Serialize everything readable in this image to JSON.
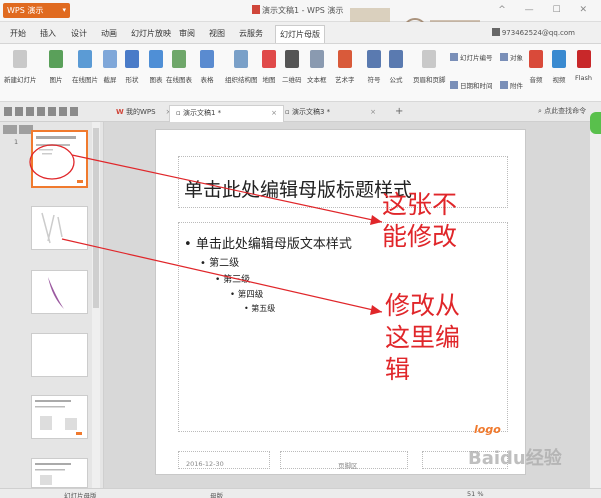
{
  "app": {
    "name": "WPS 演示",
    "window_title": "演示文稿1 - WPS 演示",
    "account": "973462524@qq.com"
  },
  "menu_tabs": [
    "开始",
    "插入",
    "设计",
    "动画",
    "幻灯片放映",
    "审阅",
    "视图",
    "云服务",
    "幻灯片母版"
  ],
  "ribbon": {
    "buttons": [
      "新建幻灯片",
      "图片",
      "在线图片",
      "截屏",
      "形状",
      "图表",
      "在线图表",
      "表格",
      "组织结构图",
      "地图",
      "二维码",
      "文本框",
      "艺术字",
      "符号",
      "公式",
      "页眉和页脚",
      "音频",
      "视频",
      "Flash"
    ],
    "small": [
      "幻灯片编号",
      "对象",
      "日期和时间",
      "附件"
    ]
  },
  "doc_tabs": {
    "home": "我的WPS",
    "tab1": "演示文稿1 *",
    "tab2": "演示文稿3 *",
    "search": "点此查找命令"
  },
  "slide": {
    "title": "单击此处编辑母版标题样式",
    "level1": "单击此处编辑母版文本样式",
    "level2": "第二级",
    "level3": "第三级",
    "level4": "第四级",
    "level5": "第五级",
    "footer_date": "2016-12-30",
    "footer_page": "页脚区",
    "logo": "logo"
  },
  "annotations": {
    "note1_line1": "这张不",
    "note1_line2": "能修改",
    "note2_line1": "修改从",
    "note2_line2": "这里编",
    "note2_line3": "辑",
    "color": "#e0262a"
  },
  "status": {
    "left": "幻灯片母版",
    "mid": "母版",
    "zoom": "51 %"
  },
  "watermark": "Baidu经验"
}
